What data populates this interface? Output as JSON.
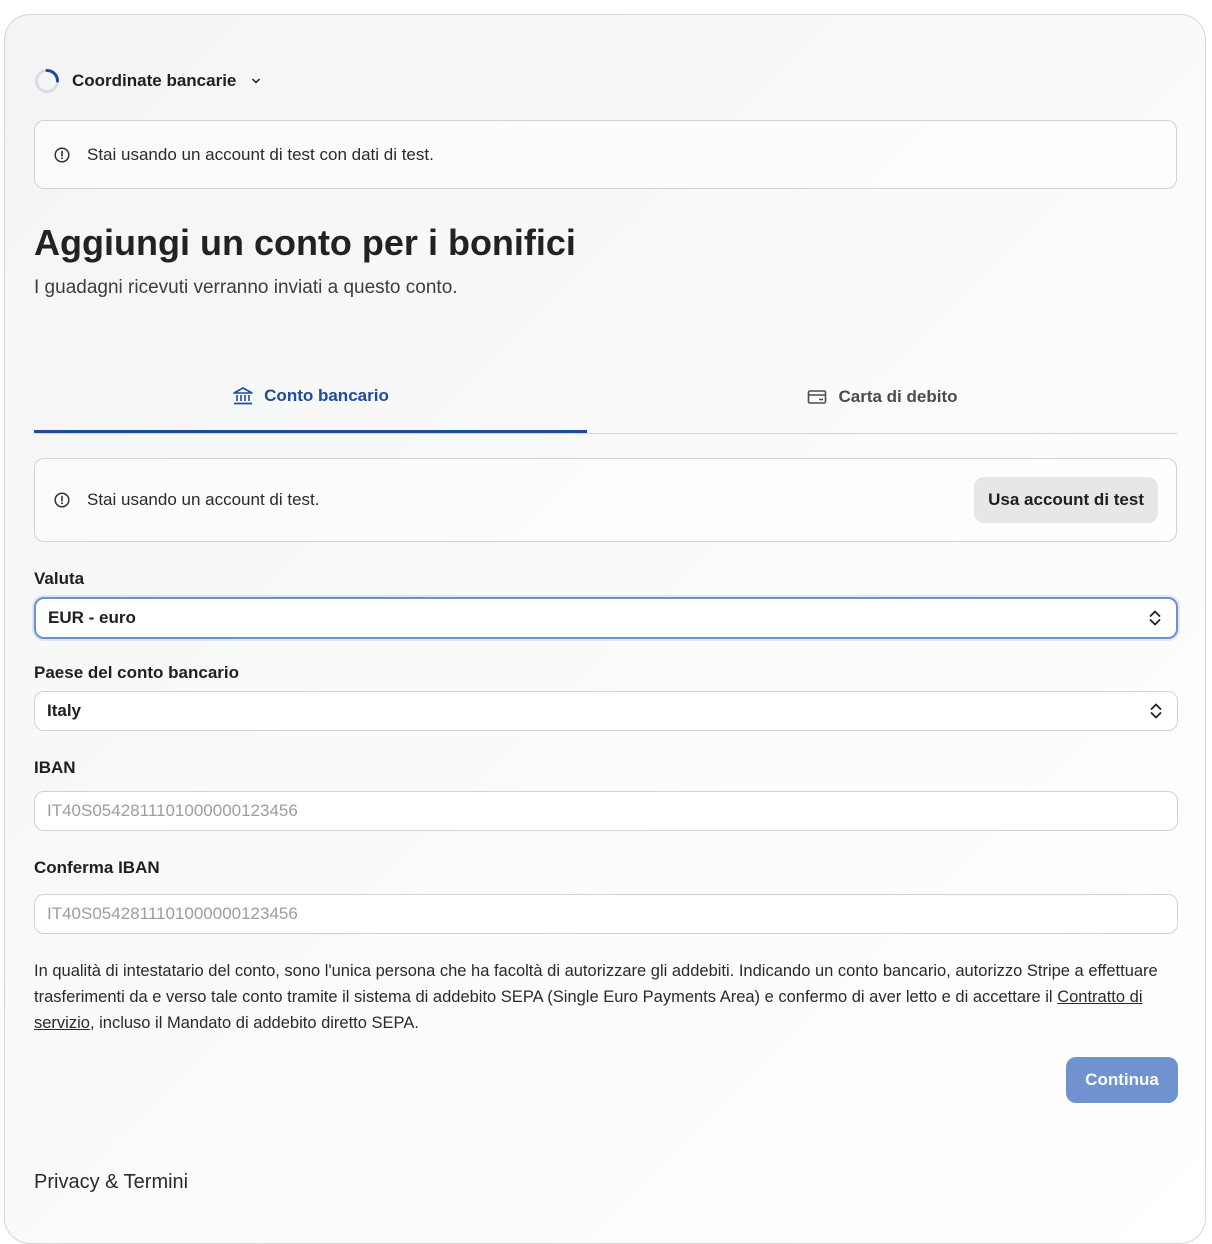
{
  "header": {
    "step_label": "Coordinate bancarie",
    "icons": {
      "progress": "progress-ring-icon",
      "expand": "chevron-down-icon"
    }
  },
  "test_notice": {
    "text": "Stai usando un account di test con dati di test.",
    "icon": "info-circle-icon"
  },
  "page": {
    "title": "Aggiungi un conto per i bonifici",
    "subtitle": "I guadagni ricevuti verranno inviati a questo conto."
  },
  "tabs": [
    {
      "label": "Conto bancario",
      "icon": "bank-icon",
      "selected": true
    },
    {
      "label": "Carta di debito",
      "icon": "card-icon",
      "selected": false
    }
  ],
  "test_account_notice": {
    "text": "Stai usando un account di test.",
    "button_label": "Usa account di test"
  },
  "form": {
    "currency": {
      "label": "Valuta",
      "value": "EUR - euro"
    },
    "country": {
      "label": "Paese del conto bancario",
      "value": "Italy"
    },
    "iban": {
      "label": "IBAN",
      "placeholder": "IT40S0542811101000000123456"
    },
    "iban_confirm": {
      "label": "Conferma IBAN",
      "placeholder": "IT40S0542811101000000123456"
    }
  },
  "legal": {
    "text_before": "In qualità di intestatario del conto, sono l'unica persona che ha facoltà di autorizzare gli addebiti. Indicando un conto bancario, autorizzo Stripe a effettuare trasferimenti da e verso tale conto tramite il sistema di addebito SEPA (Single Euro Payments Area) e confermo di aver letto e di accettare il ",
    "link": "Contratto di servizio",
    "text_after": ", incluso il Mandato di addebito diretto SEPA."
  },
  "actions": {
    "continue_label": "Continua"
  },
  "footer": {
    "link": "Privacy & Termini"
  },
  "colors": {
    "accent": "#1e4aa0",
    "primary_button": "#7093cf",
    "focus_border": "#6e8fd6"
  }
}
